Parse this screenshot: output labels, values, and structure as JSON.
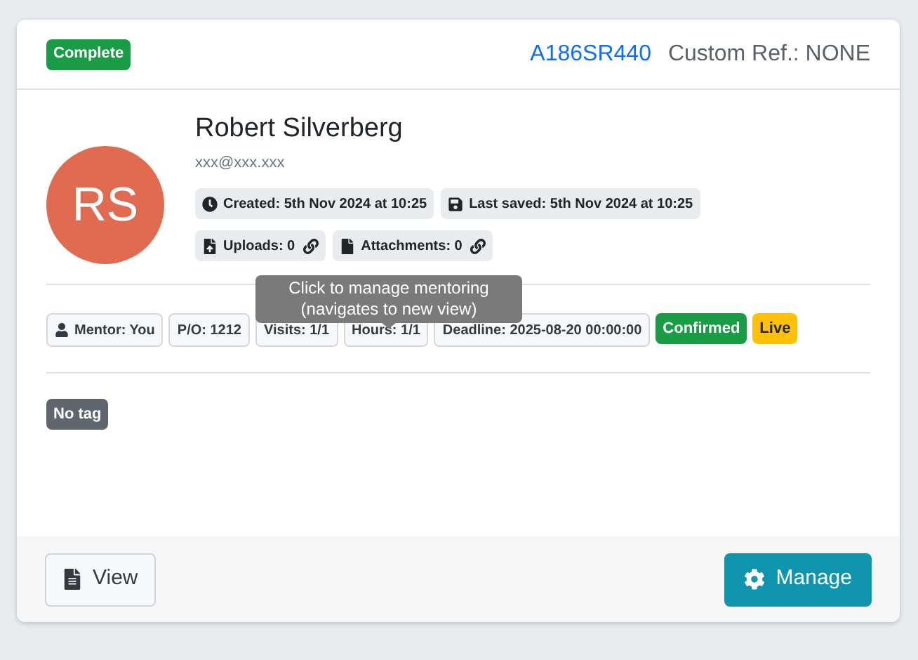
{
  "header": {
    "status": {
      "label": "Complete",
      "color": "#1a9c47"
    },
    "reference": "A186SR440",
    "custom_ref": "Custom Ref.: NONE"
  },
  "person": {
    "initials": "RS",
    "name": "Robert Silverberg",
    "email": "xxx@xxx.xxx"
  },
  "meta": [
    {
      "kind": "created",
      "text": "Created: 5th Nov 2024 at 10:25",
      "linked": false
    },
    {
      "kind": "saved",
      "text": "Last saved: 5th Nov 2024 at 10:25",
      "linked": false
    },
    {
      "kind": "uploads",
      "text": "Uploads: 0",
      "linked": true
    },
    {
      "kind": "attachments",
      "text": "Attachments: 0",
      "linked": true
    }
  ],
  "tooltip": [
    "Click to manage mentoring",
    "(navigates to new view)"
  ],
  "details": [
    {
      "kind": "mentor",
      "label": "Mentor:",
      "value": "You"
    },
    {
      "kind": "plain",
      "label": "P/O:",
      "value": "1212"
    },
    {
      "kind": "plain",
      "label": "Visits:",
      "value": "1/1"
    },
    {
      "kind": "plain",
      "label": "Hours:",
      "value": "1/1"
    },
    {
      "kind": "plain",
      "label": "Deadline:",
      "value": "2025-08-20 00:00:00"
    }
  ],
  "statuses": [
    {
      "label": "Confirmed",
      "color": "#1a9c47"
    },
    {
      "label": "Live",
      "color": "#ffc107"
    }
  ],
  "tags": [
    {
      "label": "No tag",
      "color": "#5f666d"
    }
  ],
  "actions": [
    {
      "kind": "view",
      "label": "View"
    },
    {
      "kind": "manage",
      "label": "Manage"
    }
  ]
}
